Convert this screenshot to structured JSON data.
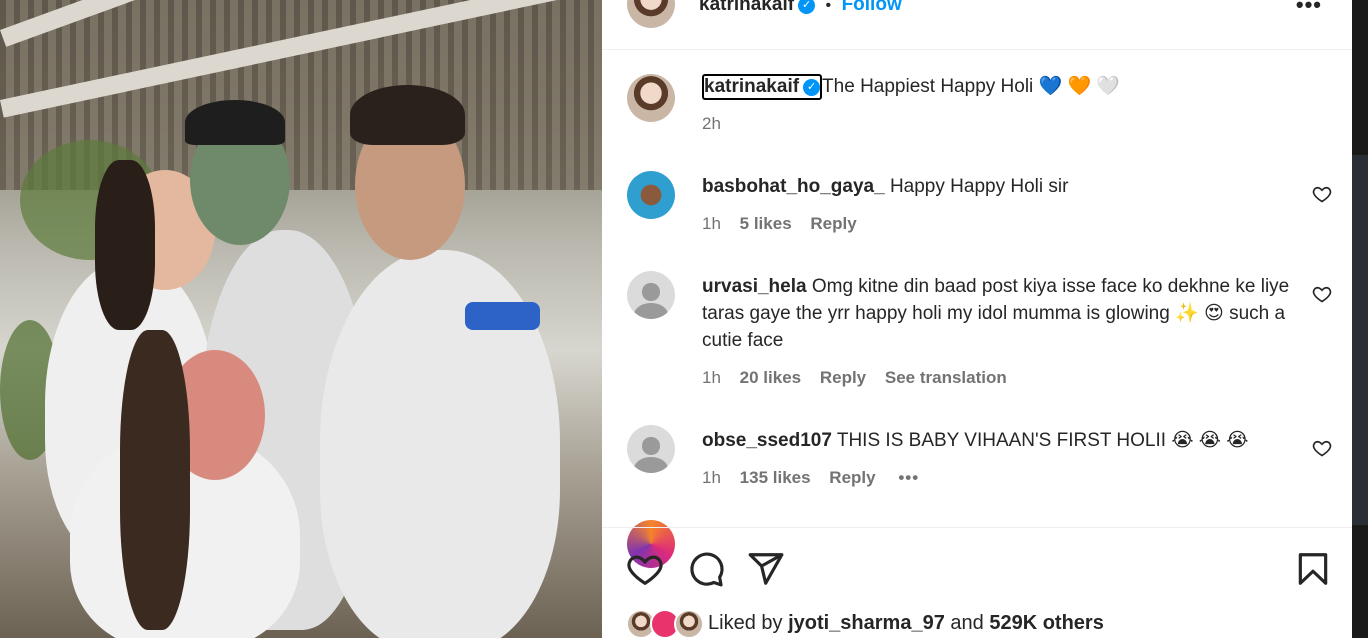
{
  "header": {
    "username": "katrinakaif",
    "separator": "•",
    "follow_label": "Follow",
    "more_label": "•••"
  },
  "caption": {
    "username": "katrinakaif",
    "text": "The Happiest Happy Holi 💙 🧡 🤍",
    "time": "2h"
  },
  "comments": [
    {
      "username": "basbohat_ho_gaya_",
      "text": "Happy Happy Holi sir",
      "time": "1h",
      "likes": "5 likes",
      "reply": "Reply"
    },
    {
      "username": "urvasi_hela",
      "text": "Omg kitne din baad post kiya isse face ko dekhne ke liye taras gaye the yrr happy holi my idol mumma is glowing ✨ 😍 such a cutie face",
      "time": "1h",
      "likes": "20 likes",
      "reply": "Reply",
      "translate": "See translation"
    },
    {
      "username": "obse_ssed107",
      "text": "THIS IS BABY VIHAAN'S FIRST HOLII 😭 😭 😭",
      "time": "1h",
      "likes": "135 likes",
      "reply": "Reply",
      "more": "•••"
    }
  ],
  "likes": {
    "prefix": "Liked by",
    "user": "jyoti_sharma_97",
    "and": "and",
    "others": "529K others"
  },
  "icons": [
    "verified-badge-icon",
    "more-icon",
    "heart-icon",
    "comment-icon",
    "share-icon",
    "bookmark-icon"
  ],
  "colors": {
    "link": "#0095f6",
    "muted": "#737373",
    "text": "#262626"
  }
}
